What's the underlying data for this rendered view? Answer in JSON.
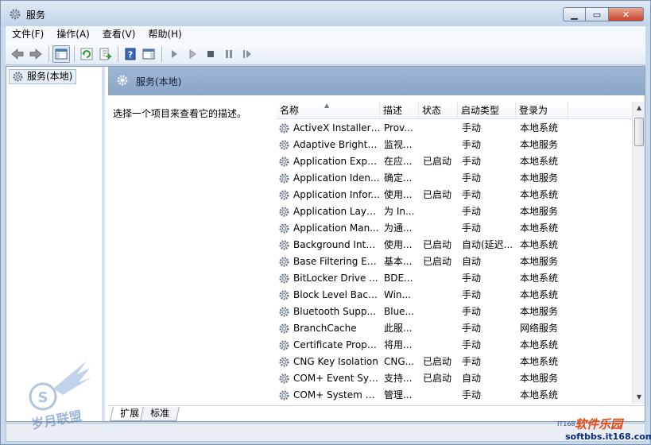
{
  "window": {
    "title": "服务"
  },
  "menu": [
    "文件(F)",
    "操作(A)",
    "查看(V)",
    "帮助(H)"
  ],
  "tree": {
    "item": "服务(本地)"
  },
  "panel": {
    "title": "服务(本地)",
    "description": "选择一个项目来查看它的描述。"
  },
  "columns": {
    "name": "名称",
    "desc": "描述",
    "status": "状态",
    "startup": "启动类型",
    "logon": "登录为"
  },
  "services": [
    {
      "name": "ActiveX Installer ...",
      "desc": "Prov...",
      "status": "",
      "startup": "手动",
      "logon": "本地系统"
    },
    {
      "name": "Adaptive Brightn...",
      "desc": "监视...",
      "status": "",
      "startup": "手动",
      "logon": "本地服务"
    },
    {
      "name": "Application Expe...",
      "desc": "在应...",
      "status": "已启动",
      "startup": "手动",
      "logon": "本地系统"
    },
    {
      "name": "Application Iden...",
      "desc": "确定...",
      "status": "",
      "startup": "手动",
      "logon": "本地服务"
    },
    {
      "name": "Application Infor...",
      "desc": "使用...",
      "status": "已启动",
      "startup": "手动",
      "logon": "本地系统"
    },
    {
      "name": "Application Laye...",
      "desc": "为 In...",
      "status": "",
      "startup": "手动",
      "logon": "本地服务"
    },
    {
      "name": "Application Man...",
      "desc": "为通...",
      "status": "",
      "startup": "手动",
      "logon": "本地系统"
    },
    {
      "name": "Background Inte...",
      "desc": "使用...",
      "status": "已启动",
      "startup": "自动(延迟...",
      "logon": "本地系统"
    },
    {
      "name": "Base Filtering En...",
      "desc": "基本...",
      "status": "已启动",
      "startup": "自动",
      "logon": "本地服务"
    },
    {
      "name": "BitLocker Drive ...",
      "desc": "BDE...",
      "status": "",
      "startup": "手动",
      "logon": "本地系统"
    },
    {
      "name": "Block Level Back...",
      "desc": "Win...",
      "status": "",
      "startup": "手动",
      "logon": "本地系统"
    },
    {
      "name": "Bluetooth Supp...",
      "desc": "Blue...",
      "status": "",
      "startup": "手动",
      "logon": "本地服务"
    },
    {
      "name": "BranchCache",
      "desc": "此服...",
      "status": "",
      "startup": "手动",
      "logon": "网络服务"
    },
    {
      "name": "Certificate Propa...",
      "desc": "将用...",
      "status": "",
      "startup": "手动",
      "logon": "本地系统"
    },
    {
      "name": "CNG Key Isolation",
      "desc": "CNG...",
      "status": "已启动",
      "startup": "手动",
      "logon": "本地系统"
    },
    {
      "name": "COM+ Event Sys...",
      "desc": "支持...",
      "status": "已启动",
      "startup": "自动",
      "logon": "本地服务"
    },
    {
      "name": "COM+ System A...",
      "desc": "管理...",
      "status": "",
      "startup": "手动",
      "logon": "本地系统"
    }
  ],
  "tabs": [
    "扩展",
    "标准"
  ],
  "watermarks": {
    "left": "岁月联盟",
    "right_main": "软件乐园",
    "right_small": "IT168",
    "right_url": "softbbs.it168.com"
  },
  "colors": {
    "header_band": "#8aa5c6",
    "window_frame": "#c9d9ec",
    "accent_green": "#2c9a2c"
  }
}
